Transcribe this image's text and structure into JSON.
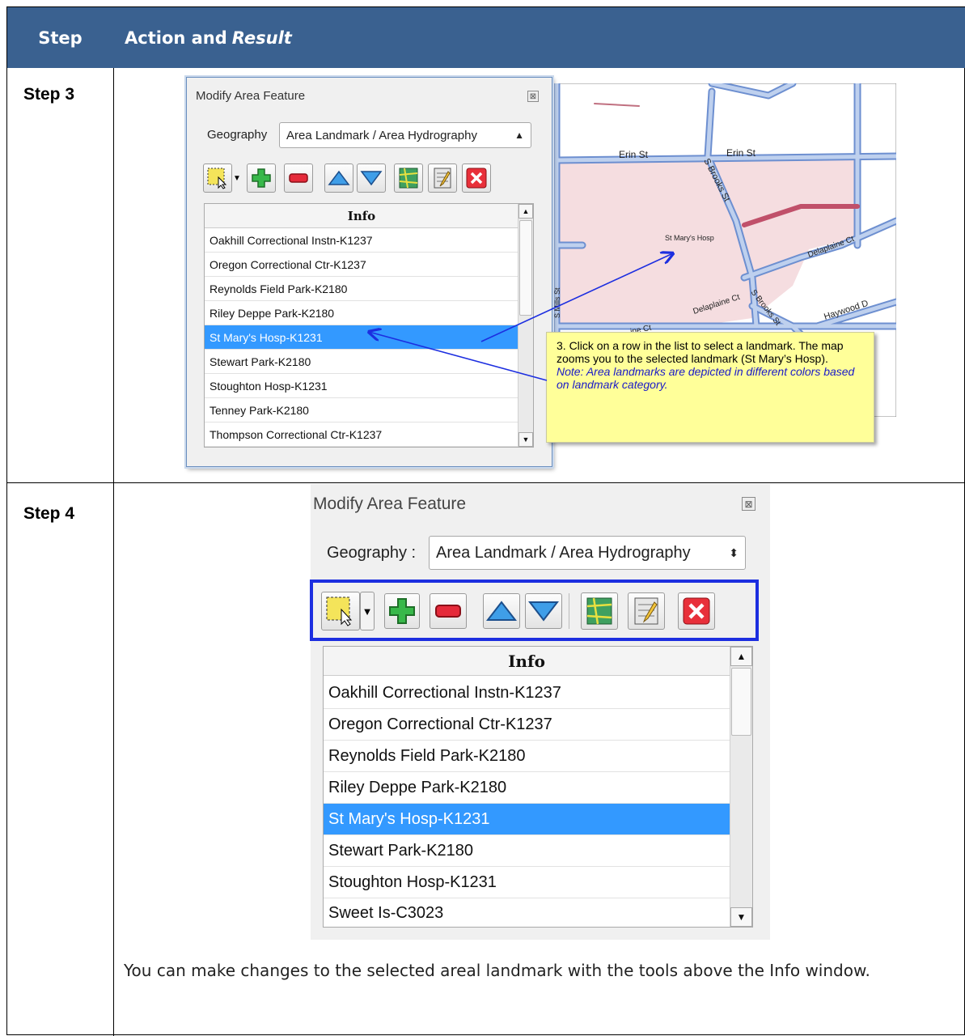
{
  "header": {
    "step": "Step",
    "action": "Action and",
    "result": "Result"
  },
  "step3": {
    "label": "Step 3",
    "panel": {
      "title": "Modify Area Feature",
      "geography_label": "Geography",
      "geography_value": "Area Landmark / Area Hydrography",
      "list_header": "Info",
      "rows": [
        "Oakhill Correctional Instn-K1237",
        "Oregon Correctional Ctr-K1237",
        "Reynolds Field Park-K2180",
        "Riley Deppe Park-K2180",
        "St Mary's Hosp-K1231",
        "Stewart Park-K2180",
        "Stoughton Hosp-K1231",
        "Tenney Park-K2180",
        "Thompson Correctional Ctr-K1237"
      ],
      "selected_index": 4
    },
    "map": {
      "streets": [
        "Erin St",
        "Erin St",
        "S Brooks St",
        "S Mills St",
        "Delaplaine Ct",
        "Delaplaine Ct",
        "S Brooks St",
        "Haywood D",
        "S Mills St",
        "ine Ct"
      ],
      "landmark_label": "St Mary's Hosp"
    },
    "callout": {
      "text": "3. Click on a row in the list to select a landmark. The map zooms you to the selected landmark (St Mary’s Hosp).",
      "note": "Note: Area landmarks are depicted in different colors based on landmark category."
    }
  },
  "step4": {
    "label": "Step 4",
    "panel": {
      "title": "Modify Area Feature",
      "geography_label": "Geography :",
      "geography_value": "Area Landmark / Area Hydrography",
      "list_header": "Info",
      "rows": [
        "Oakhill Correctional Instn-K1237",
        "Oregon Correctional Ctr-K1237",
        "Reynolds Field Park-K2180",
        "Riley Deppe Park-K2180",
        "St Mary's Hosp-K1231",
        "Stewart Park-K2180",
        "Stoughton Hosp-K1231",
        "Sweet Is-C3023"
      ],
      "selected_index": 4
    },
    "description": "You can make changes to the selected areal landmark with the tools above the Info window."
  },
  "colors": {
    "header_bg": "#3a6190",
    "selection": "#3399ff",
    "highlight_box": "#1c2ee0",
    "callout_bg": "#ffff99"
  }
}
